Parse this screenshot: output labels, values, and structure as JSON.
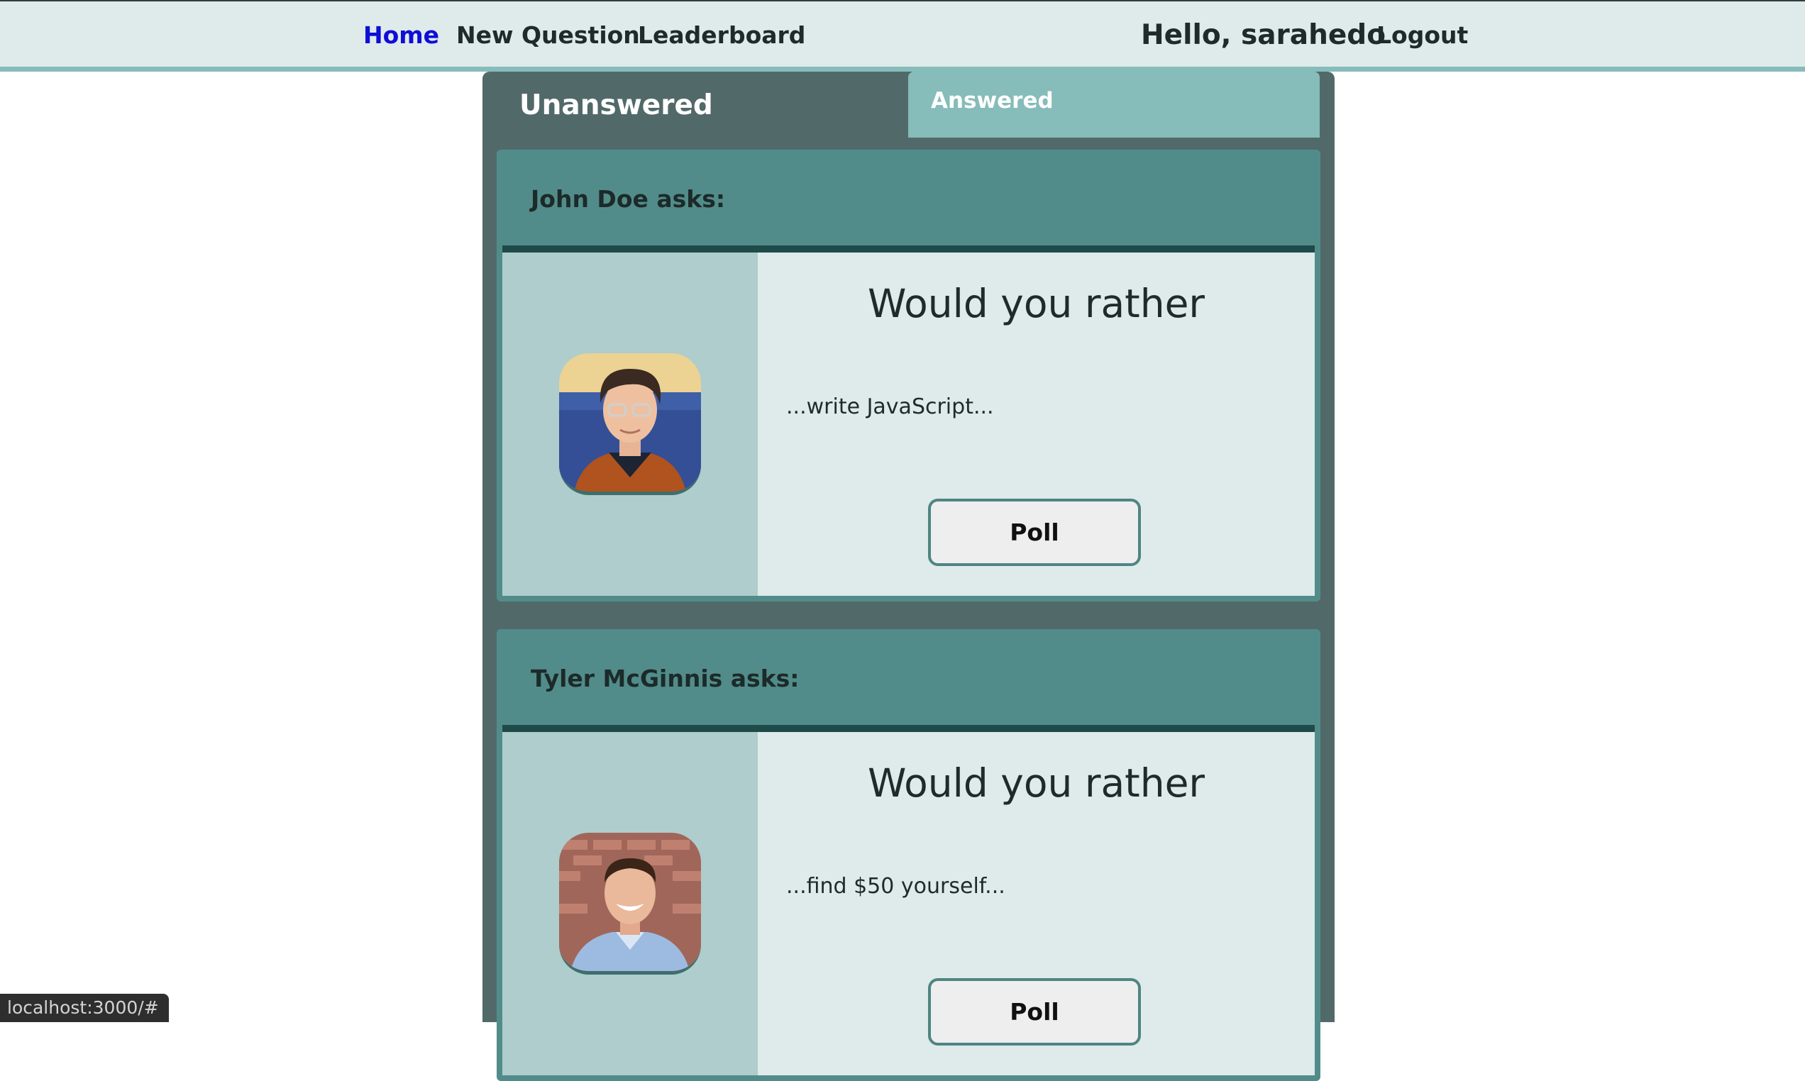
{
  "nav": {
    "home": "Home",
    "new_question": "New Question",
    "leaderboard": "Leaderboard",
    "greeting": "Hello, sarahedo",
    "logout": "Logout",
    "active_color": "#0e0ed6"
  },
  "tabs": {
    "unanswered": "Unanswered",
    "answered": "Answered"
  },
  "questions": [
    {
      "author_line": "John Doe asks:",
      "title": "Would you rather",
      "option": "...write JavaScript...",
      "button": "Poll"
    },
    {
      "author_line": "Tyler McGinnis asks:",
      "title": "Would you rather",
      "option": "...find $50 yourself...",
      "button": "Poll"
    }
  ],
  "status_bar": "localhost:3000/#",
  "colors": {
    "nav_bg": "#dfeaea",
    "nav_accent": "#86bcb9",
    "panel_bg": "#52696a",
    "card_header": "#528c8a",
    "avatar_col": "#aecdcc",
    "content_bg": "#dfeaea"
  }
}
